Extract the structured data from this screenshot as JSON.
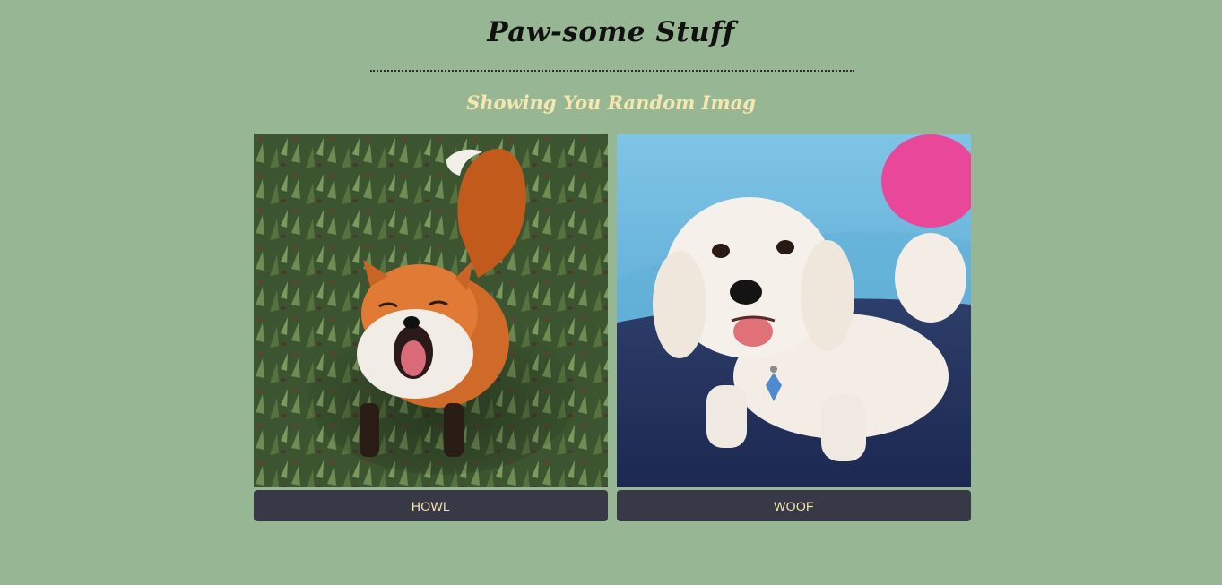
{
  "header": {
    "title": "Paw-some Stuff",
    "subtitle": "Showing You Random Imag"
  },
  "cards": [
    {
      "image_subject": "fox-photo",
      "button_label": "HOWL"
    },
    {
      "image_subject": "dog-photo",
      "button_label": "WOOF"
    }
  ],
  "colors": {
    "background": "#97b794",
    "title": "#111111",
    "subtitle": "#f6e7b0",
    "button_bg": "#373a46",
    "button_text": "#f6e7b0"
  }
}
